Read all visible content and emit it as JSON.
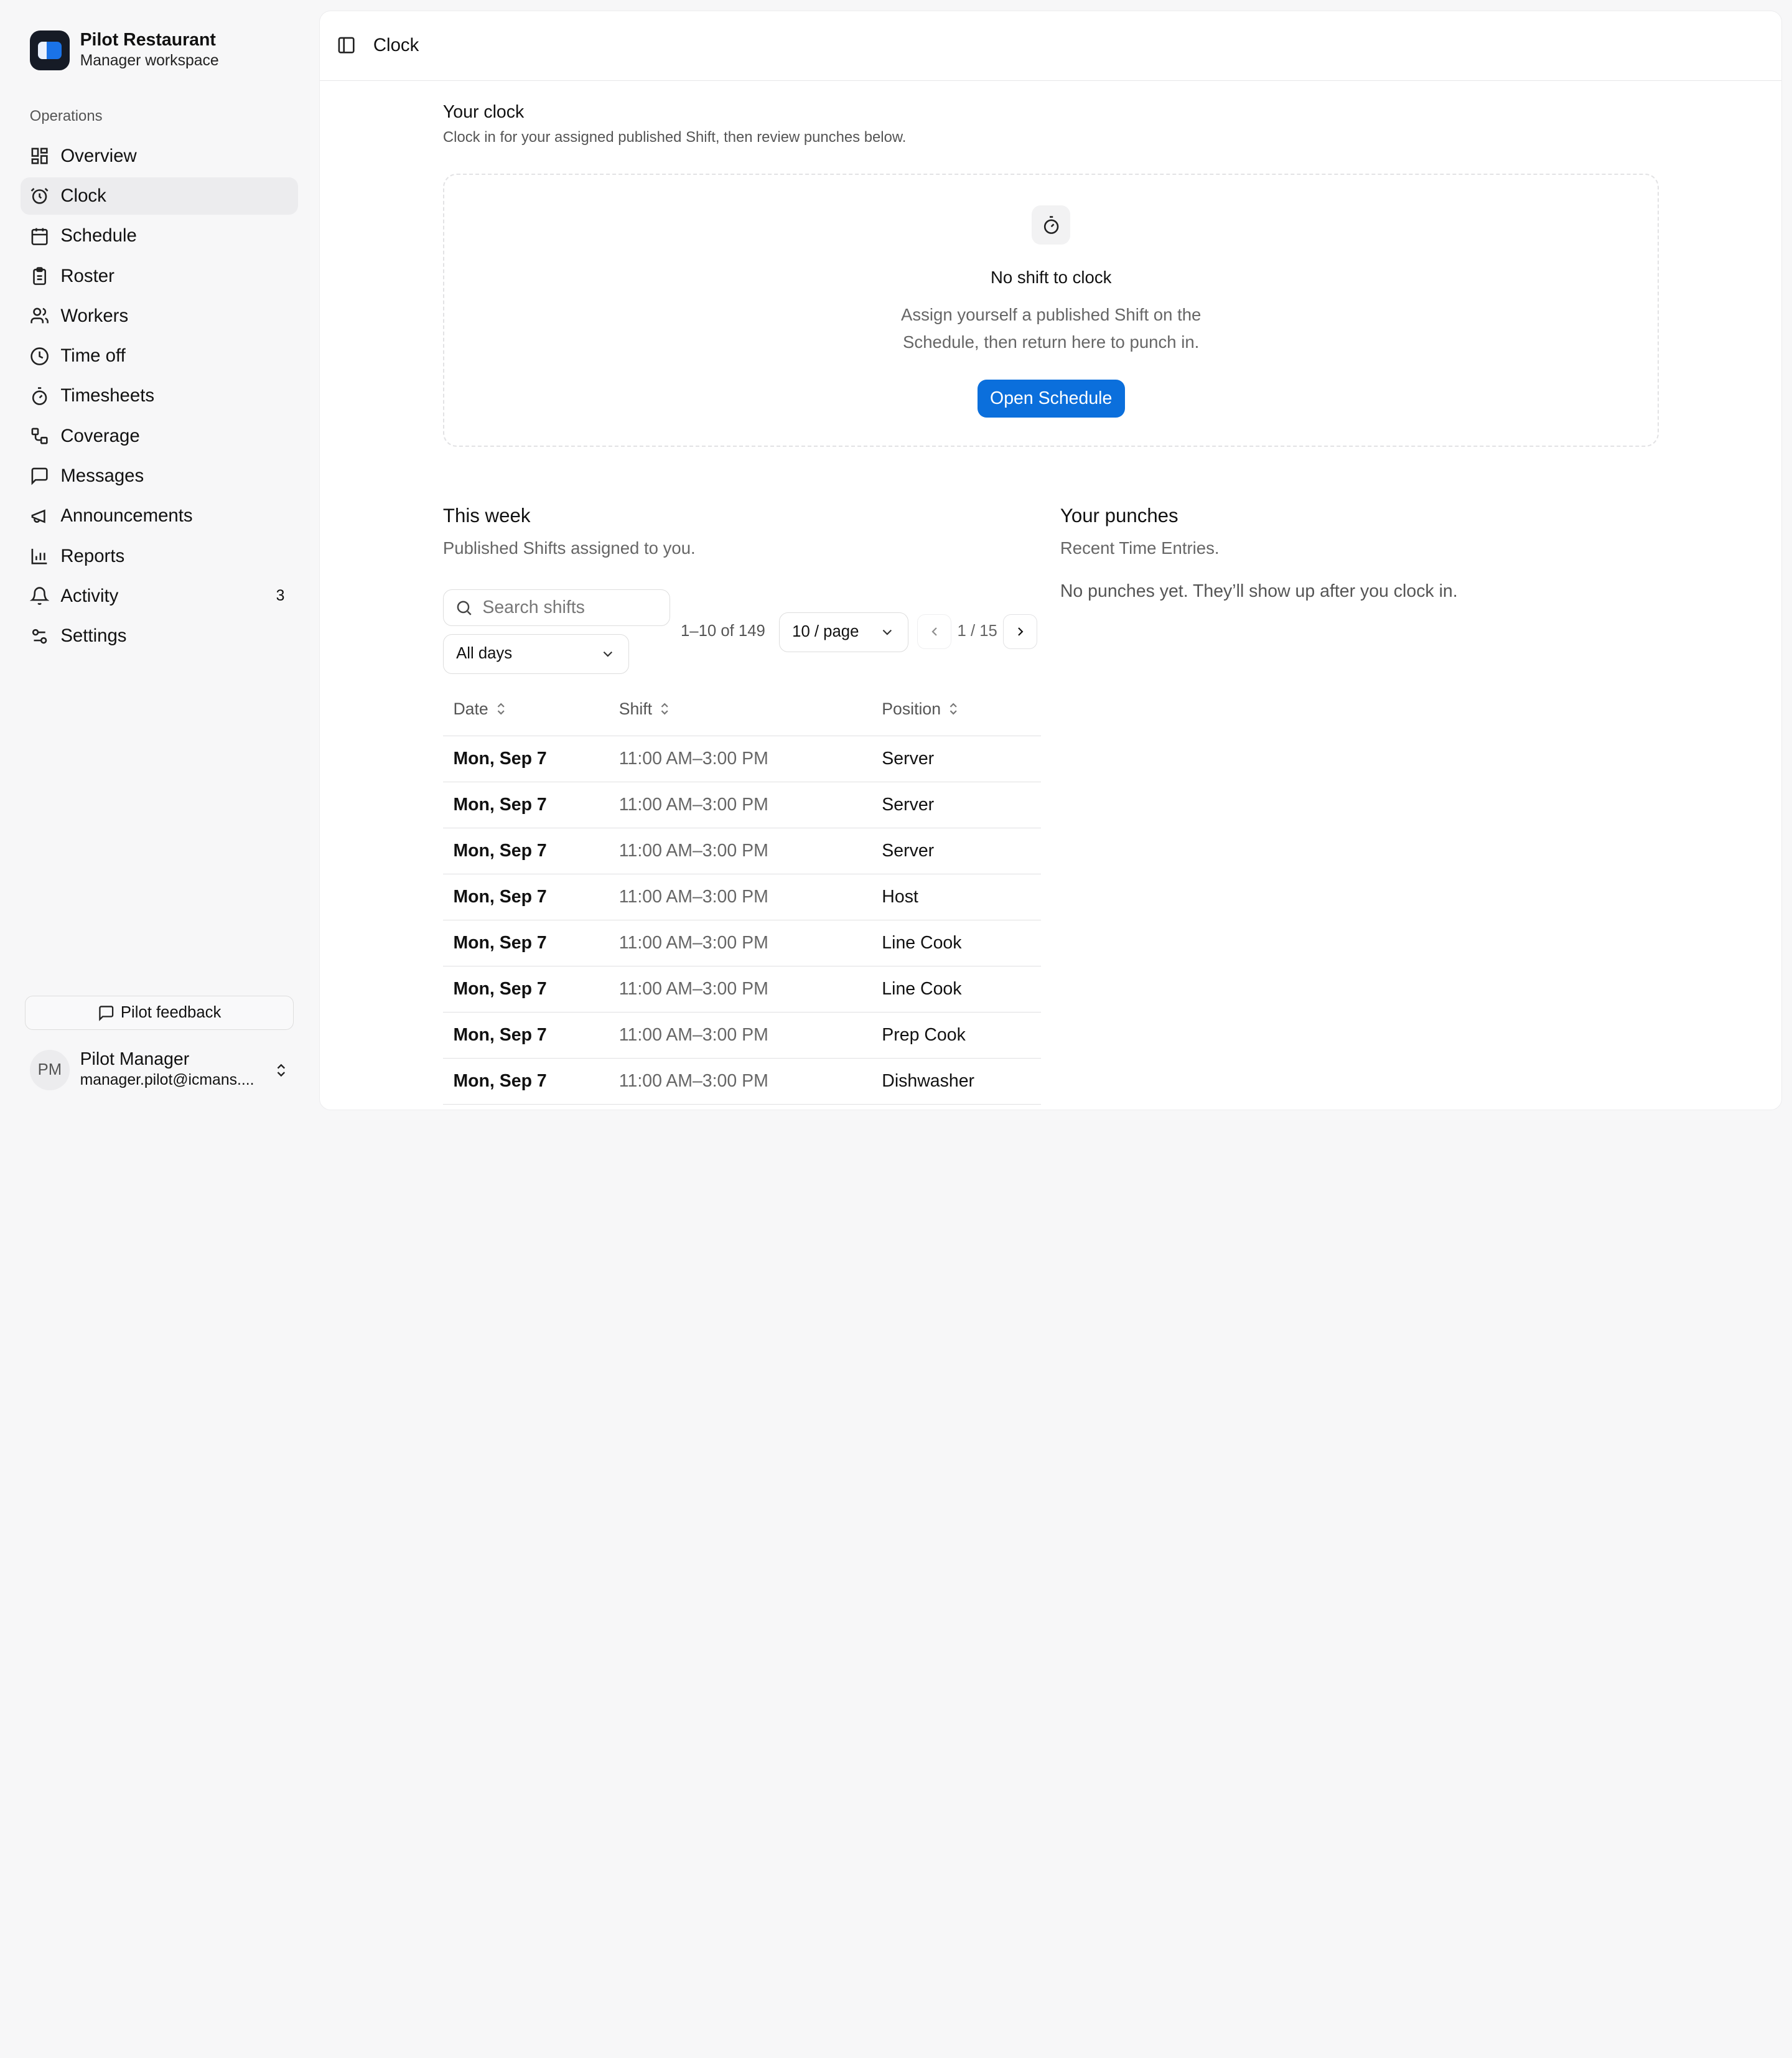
{
  "sidebar": {
    "brand_name": "Pilot Restaurant",
    "brand_sub": "Manager workspace",
    "section_label": "Operations",
    "items": [
      {
        "label": "Overview",
        "icon": "dashboard-icon"
      },
      {
        "label": "Clock",
        "icon": "alarm-clock-icon",
        "active": true
      },
      {
        "label": "Schedule",
        "icon": "calendar-icon"
      },
      {
        "label": "Roster",
        "icon": "clipboard-icon"
      },
      {
        "label": "Workers",
        "icon": "users-icon"
      },
      {
        "label": "Time off",
        "icon": "clock-icon"
      },
      {
        "label": "Timesheets",
        "icon": "stopwatch-icon"
      },
      {
        "label": "Coverage",
        "icon": "route-icon"
      },
      {
        "label": "Messages",
        "icon": "message-icon"
      },
      {
        "label": "Announcements",
        "icon": "megaphone-icon"
      },
      {
        "label": "Reports",
        "icon": "bar-chart-icon"
      },
      {
        "label": "Activity",
        "icon": "bell-icon",
        "count": "3"
      },
      {
        "label": "Settings",
        "icon": "sliders-icon"
      }
    ],
    "feedback_label": "Pilot feedback",
    "user": {
      "initials": "PM",
      "name": "Pilot Manager",
      "email": "manager.pilot@icmans...."
    }
  },
  "header": {
    "title": "Clock"
  },
  "clock": {
    "title": "Your clock",
    "subtitle": "Clock in for your assigned published Shift, then review punches below.",
    "empty_title": "No shift to clock",
    "empty_desc": "Assign yourself a published Shift on the Schedule, then return here to punch in.",
    "button_label": "Open Schedule"
  },
  "week": {
    "title": "This week",
    "subtitle": "Published Shifts assigned to you.",
    "search_placeholder": "Search shifts",
    "day_filter": "All days",
    "range": "1–10 of 149",
    "per_page": "10 / page",
    "page": "1 / 15",
    "columns": [
      "Date",
      "Shift",
      "Position"
    ],
    "rows": [
      {
        "date": "Mon, Sep 7",
        "shift": "11:00 AM–3:00 PM",
        "position": "Server"
      },
      {
        "date": "Mon, Sep 7",
        "shift": "11:00 AM–3:00 PM",
        "position": "Server"
      },
      {
        "date": "Mon, Sep 7",
        "shift": "11:00 AM–3:00 PM",
        "position": "Server"
      },
      {
        "date": "Mon, Sep 7",
        "shift": "11:00 AM–3:00 PM",
        "position": "Host"
      },
      {
        "date": "Mon, Sep 7",
        "shift": "11:00 AM–3:00 PM",
        "position": "Line Cook"
      },
      {
        "date": "Mon, Sep 7",
        "shift": "11:00 AM–3:00 PM",
        "position": "Line Cook"
      },
      {
        "date": "Mon, Sep 7",
        "shift": "11:00 AM–3:00 PM",
        "position": "Prep Cook"
      },
      {
        "date": "Mon, Sep 7",
        "shift": "11:00 AM–3:00 PM",
        "position": "Dishwasher"
      }
    ]
  },
  "punches": {
    "title": "Your punches",
    "subtitle": "Recent Time Entries.",
    "empty": "No punches yet. They’ll show up after you clock in."
  }
}
